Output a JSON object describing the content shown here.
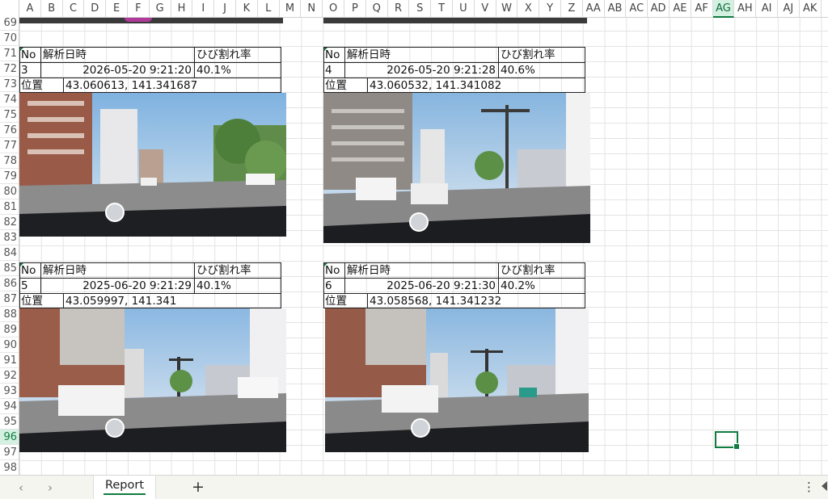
{
  "columns": [
    "A",
    "B",
    "C",
    "D",
    "E",
    "F",
    "G",
    "H",
    "I",
    "J",
    "K",
    "L",
    "M",
    "N",
    "O",
    "P",
    "Q",
    "R",
    "S",
    "T",
    "U",
    "V",
    "W",
    "X",
    "Y",
    "Z",
    "AA",
    "AB",
    "AC",
    "AD",
    "AE",
    "AF",
    "AG",
    "AH",
    "AI",
    "AJ",
    "AK"
  ],
  "selected_column": "AG",
  "rows": [
    "69",
    "70",
    "71",
    "72",
    "73",
    "74",
    "75",
    "76",
    "77",
    "78",
    "79",
    "80",
    "81",
    "82",
    "83",
    "84",
    "85",
    "86",
    "87",
    "88",
    "89",
    "90",
    "91",
    "92",
    "93",
    "94",
    "95",
    "96",
    "97",
    "98"
  ],
  "selected_row": "96",
  "records": [
    {
      "header_no": "No",
      "header_date": "解析日時",
      "header_rate": "ひび割れ率",
      "no": "3",
      "datetime": "2026-05-20 9:21:20",
      "rate": "40.1%",
      "location_label": "位置",
      "location": "43.060613, 141.341687"
    },
    {
      "header_no": "No",
      "header_date": "解析日時",
      "header_rate": "ひび割れ率",
      "no": "4",
      "datetime": "2026-05-20 9:21:28",
      "rate": "40.6%",
      "location_label": "位置",
      "location": "43.060532, 141.341082"
    },
    {
      "header_no": "No",
      "header_date": "解析日時",
      "header_rate": "ひび割れ率",
      "no": "5",
      "datetime": "2025-06-20 9:21:29",
      "rate": "40.1%",
      "location_label": "位置",
      "location": "43.059997, 141.341"
    },
    {
      "header_no": "No",
      "header_date": "解析日時",
      "header_rate": "ひび割れ率",
      "no": "6",
      "datetime": "2025-06-20 9:21:30",
      "rate": "40.2%",
      "location_label": "位置",
      "location": "43.058568, 141.341232"
    }
  ],
  "sheet_tabs": {
    "active": "Report",
    "add_label": "+",
    "prev_icon": "‹",
    "next_icon": "›",
    "more_icon": "⋮"
  },
  "colors": {
    "accent": "#107c41",
    "selected_header_bg": "#d3f0e0"
  }
}
